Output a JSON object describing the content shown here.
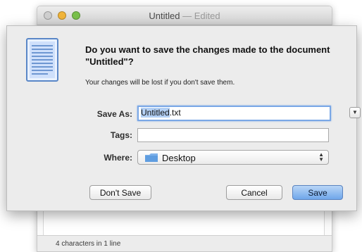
{
  "window": {
    "title": "Untitled",
    "title_separator": " — ",
    "title_status": "Edited",
    "status_bar": "4 characters in 1 line"
  },
  "sheet": {
    "app_icon": "textedit-document-icon",
    "heading": "Do you want to save the changes made to the document \"Untitled\"?",
    "subtext": "Your changes will be lost if you don't save them.",
    "save_as_label": "Save As:",
    "save_as_value": "Untitled.txt",
    "save_as_selected_part": "Untitled",
    "save_as_unselected_part": ".txt",
    "tags_label": "Tags:",
    "tags_value": "",
    "where_label": "Where:",
    "where_value": "Desktop",
    "where_icon": "folder-icon",
    "dont_save_label": "Don't Save",
    "cancel_label": "Cancel",
    "save_label": "Save"
  },
  "colors": {
    "accent": "#6fa6ea",
    "selection": "#b3d0f5",
    "sheet_bg": "#ececec"
  }
}
